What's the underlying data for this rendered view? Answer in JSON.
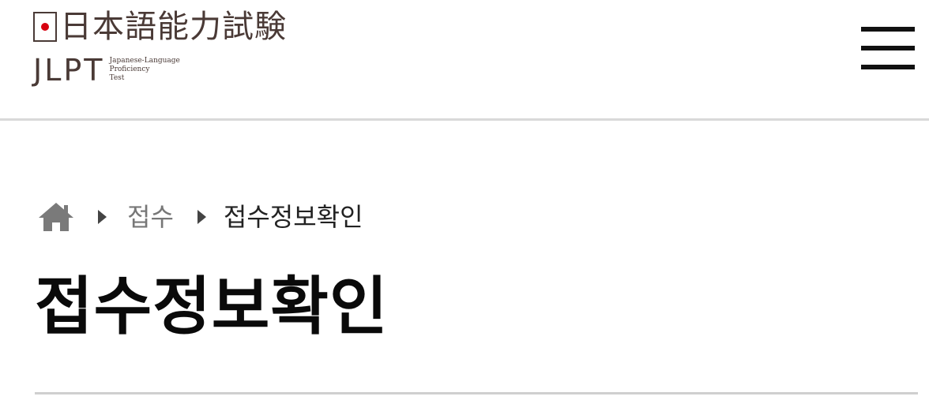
{
  "header": {
    "logo": {
      "kanji": "日本語能力試験",
      "abbr": "JLPT",
      "subtitle_lines": [
        "Japanese-Language",
        "Proficiency",
        "Test"
      ]
    },
    "menu_icon": "hamburger-menu-icon"
  },
  "breadcrumb": {
    "home_icon": "home-icon",
    "separator_icon": "triangle-right-icon",
    "items": [
      {
        "label": "접수"
      },
      {
        "label": "접수정보확인"
      }
    ]
  },
  "main": {
    "title": "접수정보확인"
  },
  "colors": {
    "logo_brown": "#4a3a36",
    "logo_red": "#d7000f",
    "breadcrumb_link": "#777777",
    "title": "#0a0a0a",
    "divider": "#cfcfcf"
  }
}
